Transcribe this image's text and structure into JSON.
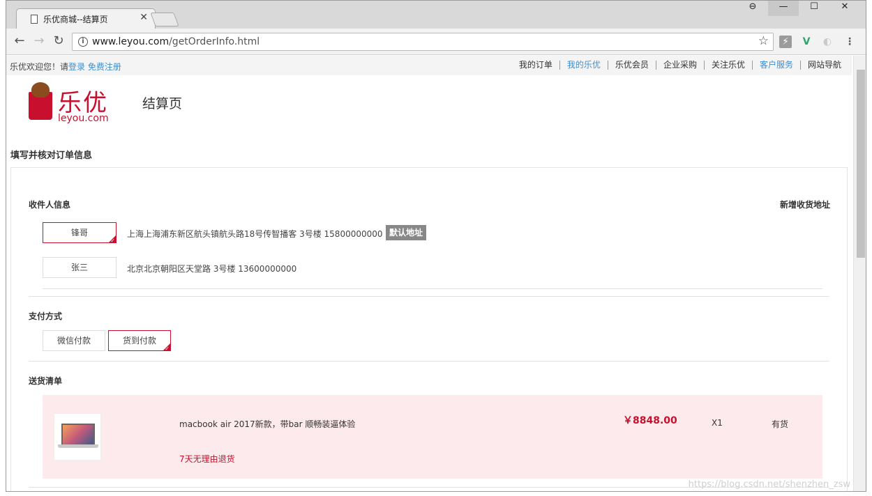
{
  "browser": {
    "tab_title": "乐优商城--结算页",
    "tab_close": "×",
    "url_host": "www.leyou.com",
    "url_path": "/getOrderInfo.html",
    "icons": {
      "back": "←",
      "forward": "→",
      "reload": "↻",
      "info": "i",
      "star": "☆",
      "account": "⊖",
      "minimize": "—",
      "maximize": "☐",
      "close": "✕",
      "ext1": "⚡",
      "ext2": "V",
      "ext3": "◐",
      "menu": "⋮"
    }
  },
  "topbar": {
    "welcome_prefix": "乐优欢迎您！请",
    "login": "登录",
    "register": "免费注册",
    "links": [
      {
        "label": "我的订单",
        "blue": false
      },
      {
        "label": "我的乐优",
        "blue": true
      },
      {
        "label": "乐优会员",
        "blue": false
      },
      {
        "label": "企业采购",
        "blue": false
      },
      {
        "label": "关注乐优",
        "blue": false
      },
      {
        "label": "客户服务",
        "blue": true
      },
      {
        "label": "网站导航",
        "blue": false
      }
    ]
  },
  "header": {
    "logo_cn": "乐优",
    "logo_en": "leyou.com",
    "page_title": "结算页"
  },
  "main": {
    "section_title": "填写并核对订单信息",
    "receiver": {
      "title": "收件人信息",
      "add_address": "新增收货地址",
      "addresses": [
        {
          "name": "锋哥",
          "detail": "上海上海浦东新区航头镇航头路18号传智播客 3号楼 15800000000",
          "is_default": true,
          "selected": true
        },
        {
          "name": "张三",
          "detail": "北京北京朝阳区天堂路 3号楼 13600000000",
          "is_default": false,
          "selected": false
        }
      ],
      "default_badge": "默认地址"
    },
    "payment": {
      "title": "支付方式",
      "options": [
        {
          "label": "微信付款",
          "selected": false
        },
        {
          "label": "货到付款",
          "selected": true
        }
      ]
    },
    "delivery": {
      "title": "送货清单",
      "item": {
        "name": "macbook air 2017新款，带bar 顺畅装逼体验",
        "policy": "7天无理由退货",
        "price": "￥8848.00",
        "quantity": "X1",
        "stock": "有货"
      }
    }
  },
  "watermark": "https://blog.csdn.net/shenzhen_zsw",
  "colors": {
    "accent": "#c8102e",
    "link": "#3e8ed0",
    "item_bg": "#fdeaec"
  }
}
